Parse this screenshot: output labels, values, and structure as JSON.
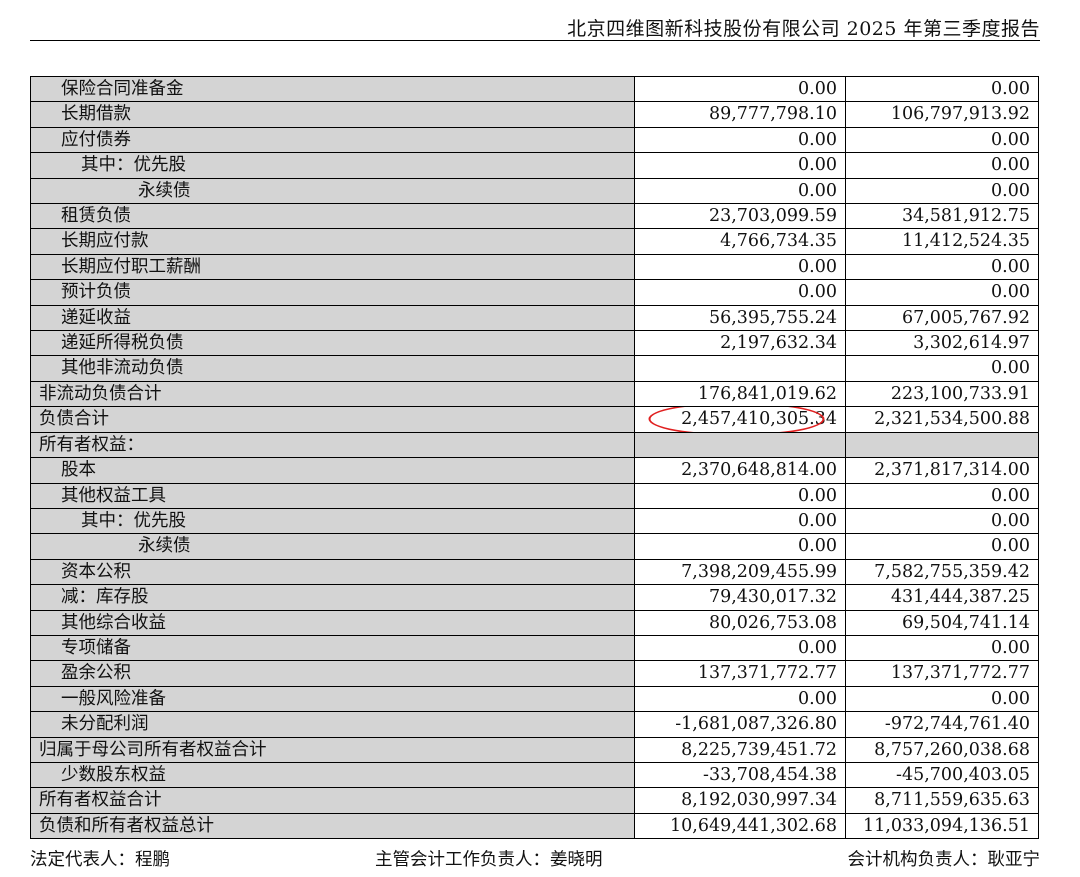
{
  "header": {
    "title": "北京四维图新科技股份有限公司 2025 年第三季度报告"
  },
  "rows": [
    {
      "label": "保险合同准备金",
      "col1": "0.00",
      "col2": "0.00"
    },
    {
      "label": "长期借款",
      "col1": "89,777,798.10",
      "col2": "106,797,913.92"
    },
    {
      "label": "应付债券",
      "col1": "0.00",
      "col2": "0.00"
    },
    {
      "label": "其中：优先股",
      "col1": "0.00",
      "col2": "0.00"
    },
    {
      "label": "永续债",
      "col1": "0.00",
      "col2": "0.00"
    },
    {
      "label": "租赁负债",
      "col1": "23,703,099.59",
      "col2": "34,581,912.75"
    },
    {
      "label": "长期应付款",
      "col1": "4,766,734.35",
      "col2": "11,412,524.35"
    },
    {
      "label": "长期应付职工薪酬",
      "col1": "0.00",
      "col2": "0.00"
    },
    {
      "label": "预计负债",
      "col1": "0.00",
      "col2": "0.00"
    },
    {
      "label": "递延收益",
      "col1": "56,395,755.24",
      "col2": "67,005,767.92"
    },
    {
      "label": "递延所得税负债",
      "col1": "2,197,632.34",
      "col2": "3,302,614.97"
    },
    {
      "label": "其他非流动负债",
      "col1": "",
      "col2": "0.00"
    },
    {
      "label": "非流动负债合计",
      "col1": "176,841,019.62",
      "col2": "223,100,733.91"
    },
    {
      "label": "负债合计",
      "col1": "2,457,410,305.34",
      "col2": "2,321,534,500.88"
    },
    {
      "label": "所有者权益：",
      "col1": "",
      "col2": ""
    },
    {
      "label": "股本",
      "col1": "2,370,648,814.00",
      "col2": "2,371,817,314.00"
    },
    {
      "label": "其他权益工具",
      "col1": "0.00",
      "col2": "0.00"
    },
    {
      "label": "其中：优先股",
      "col1": "0.00",
      "col2": "0.00"
    },
    {
      "label": "永续债",
      "col1": "0.00",
      "col2": "0.00"
    },
    {
      "label": "资本公积",
      "col1": "7,398,209,455.99",
      "col2": "7,582,755,359.42"
    },
    {
      "label": "减：库存股",
      "col1": "79,430,017.32",
      "col2": "431,444,387.25"
    },
    {
      "label": "其他综合收益",
      "col1": "80,026,753.08",
      "col2": "69,504,741.14"
    },
    {
      "label": "专项储备",
      "col1": "0.00",
      "col2": "0.00"
    },
    {
      "label": "盈余公积",
      "col1": "137,371,772.77",
      "col2": "137,371,772.77"
    },
    {
      "label": "一般风险准备",
      "col1": "0.00",
      "col2": "0.00"
    },
    {
      "label": "未分配利润",
      "col1": "-1,681,087,326.80",
      "col2": "-972,744,761.40"
    },
    {
      "label": "归属于母公司所有者权益合计",
      "col1": "8,225,739,451.72",
      "col2": "8,757,260,038.68"
    },
    {
      "label": "少数股东权益",
      "col1": "-33,708,454.38",
      "col2": "-45,700,403.05"
    },
    {
      "label": "所有者权益合计",
      "col1": "8,192,030,997.34",
      "col2": "8,711,559,635.63"
    },
    {
      "label": "负债和所有者权益总计",
      "col1": "10,649,441,302.68",
      "col2": "11,033,094,136.51"
    }
  ],
  "footer": {
    "legal_rep": "法定代表人：程鹏",
    "accounting_head": "主管会计工作负责人：姜晓明",
    "accounting_org_head": "会计机构负责人：耿亚宁"
  },
  "annotation": {
    "color": "#e02020"
  }
}
